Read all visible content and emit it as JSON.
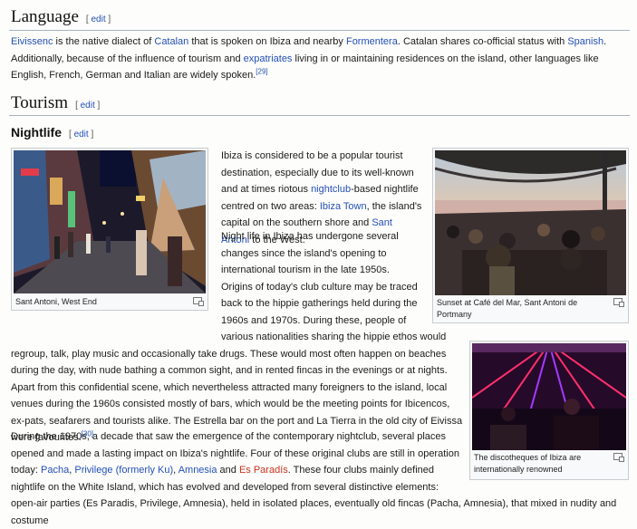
{
  "language": {
    "heading": "Language",
    "edit": "edit",
    "p1": "Eivissenc",
    "p2": " is the native dialect of ",
    "p3": "Catalan",
    "p4": " that is spoken on Ibiza and nearby ",
    "p5": "Formentera",
    "p6": ". Catalan shares co-official status with ",
    "p7": "Spanish",
    "p8": ". Additionally, because of the influence of tourism and ",
    "p9": "expatriates",
    "p10": " living in or maintaining residences on the island, other languages like English, French, German and Italian are widely spoken.",
    "ref": "[29]"
  },
  "tourism": {
    "heading": "Tourism",
    "edit": "edit"
  },
  "nightlife": {
    "heading": "Nightlife",
    "edit": "edit",
    "a1": "Ibiza is considered to be a popular tourist destination, especially due to its well-known and at times riotous ",
    "a2": "nightclub",
    "a3": "-based nightlife centred on two areas: ",
    "a4": "Ibiza Town",
    "a5": ", the island's capital on the southern shore and ",
    "a6": "Sant Antoni",
    "a7": " to the West.",
    "b1": "Night life in Ibiza has undergone several changes since the island's opening to international tourism in the late 1950s. Origins of today's club culture may be traced back to the hippie gatherings held during the 1960s and 1970s. During these, people of various nationalities sharing the hippie ethos would regroup, talk, play music and occasionally take drugs. These would most often happen on beaches during the day, with nude bathing a common sight, and in rented fincas in the evenings or at nights. Apart from this confidential scene, which nevertheless attracted many foreigners to the island, local venues during the 1960s consisted mostly of bars, which would be the meeting points for Ibicencos, ex-pats, seafarers and tourists alike. The Estrella bar on the port and La Tierra in the old city of Eivissa were favourites.",
    "b_ref": "[30]",
    "c1": "During the 1970s, a decade that saw the emergence of the contemporary nightclub, several places opened and made a lasting impact on Ibiza's nightlife. Four of these original clubs are still in operation today: ",
    "c2": "Pacha",
    "c3": ", ",
    "c4": "Privilege (formerly Ku)",
    "c5": ", ",
    "c6": "Amnesia",
    "c7": " and ",
    "c8": "Es Paradís",
    "c9": ". These four clubs mainly defined nightlife on the White Island, which has evolved and developed from several distinctive elements: open-air parties (Es Paradis, Privilege, Amnesia), held in isolated places, eventually old fincas (Pacha, Amnesia), that mixed in nudity and costume"
  },
  "figures": {
    "fig1_caption": "Sant Antoni, West End",
    "fig2_caption": "Sunset at Café del Mar, Sant Antoni de Portmany",
    "fig3_caption": "The discotheques of Ibiza are internationally renowned"
  }
}
